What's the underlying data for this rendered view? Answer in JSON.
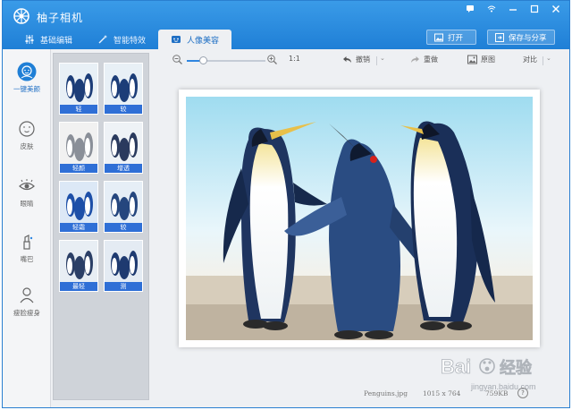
{
  "app": {
    "title": "柚子相机"
  },
  "tabs": [
    {
      "label": "基础编辑",
      "icon": "sliders-icon"
    },
    {
      "label": "智能特效",
      "icon": "magic-wand-icon"
    },
    {
      "label": "人像美容",
      "icon": "portrait-icon",
      "active": true
    }
  ],
  "header_buttons": {
    "open": "打开",
    "save_share": "保存与分享"
  },
  "sidebar": {
    "items": [
      {
        "label": "一键美颜",
        "icon": "face-beauty-icon",
        "active": true
      },
      {
        "label": "皮肤",
        "icon": "skin-icon"
      },
      {
        "label": "眼睛",
        "icon": "eye-icon"
      },
      {
        "label": "嘴巴",
        "icon": "lipstick-icon"
      },
      {
        "label": "瘦脸瘦身",
        "icon": "slim-body-icon"
      }
    ]
  },
  "filters": [
    {
      "label": "轻"
    },
    {
      "label": "较"
    },
    {
      "label": "轻颜"
    },
    {
      "label": "增透"
    },
    {
      "label": "轻霜"
    },
    {
      "label": "较"
    },
    {
      "label": "最轻"
    },
    {
      "label": "测"
    }
  ],
  "toolbar": {
    "zoom_level": 0.2,
    "zoom_ratio": "1:1",
    "undo": "撤销",
    "redo": "重做",
    "original": "原图",
    "compare": "对比"
  },
  "status": {
    "filename": "Penguins.jpg",
    "dimensions": "1015 x 764",
    "filesize": "759KB",
    "help": "?"
  },
  "watermark": {
    "brand": "Bai",
    "suffix": "经验",
    "url": "jingyan.baidu.com"
  },
  "colors": {
    "title_bar": "#1f7fd6",
    "accent": "#2f6fd6",
    "filter_caption": "#2f6fd6"
  }
}
